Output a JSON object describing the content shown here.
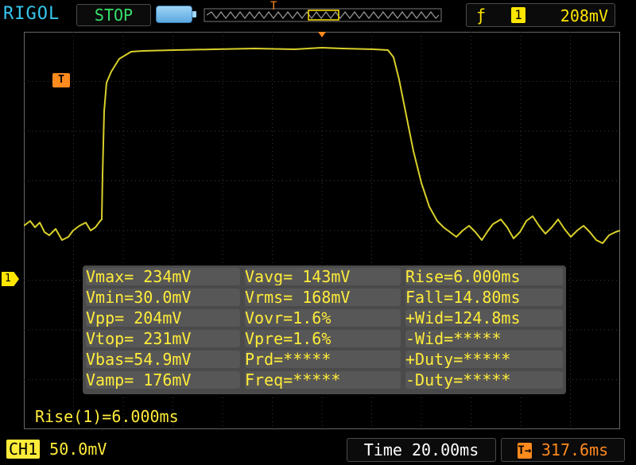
{
  "header": {
    "brand": "RIGOL",
    "run_state": "STOP",
    "trigger_marker": "T",
    "trigger_channel": "1",
    "trigger_level": "208mV"
  },
  "screen": {
    "channel_marker": "1",
    "trigger_flag": "T"
  },
  "measurements": {
    "col1": [
      "Vmax= 234mV",
      "Vmin=30.0mV",
      "Vpp= 204mV",
      "Vtop= 231mV",
      "Vbas=54.9mV",
      "Vamp= 176mV"
    ],
    "col2": [
      "Vavg= 143mV",
      "Vrms= 168mV",
      "Vovr=1.6%",
      "Vpre=1.6%",
      "Prd=*****",
      "Freq=*****"
    ],
    "col3": [
      "Rise=6.000ms",
      "Fall=14.80ms",
      "+Wid=124.8ms",
      "-Wid=*****",
      "+Duty=*****",
      "-Duty=*****"
    ]
  },
  "rise_readout": "Rise(1)=6.000ms",
  "footer": {
    "channel_badge": "CH1",
    "channel_scale": "50.0mV",
    "time_label": "Time 20.00ms",
    "trigger_position": "317.6ms"
  },
  "colors": {
    "trace": "#d8cf2a",
    "grid": "#3a3a3a",
    "brand": "#35c6ee",
    "stop": "#35e06a",
    "trigger": "#ff8a1e",
    "text": "#ffec3a"
  }
}
